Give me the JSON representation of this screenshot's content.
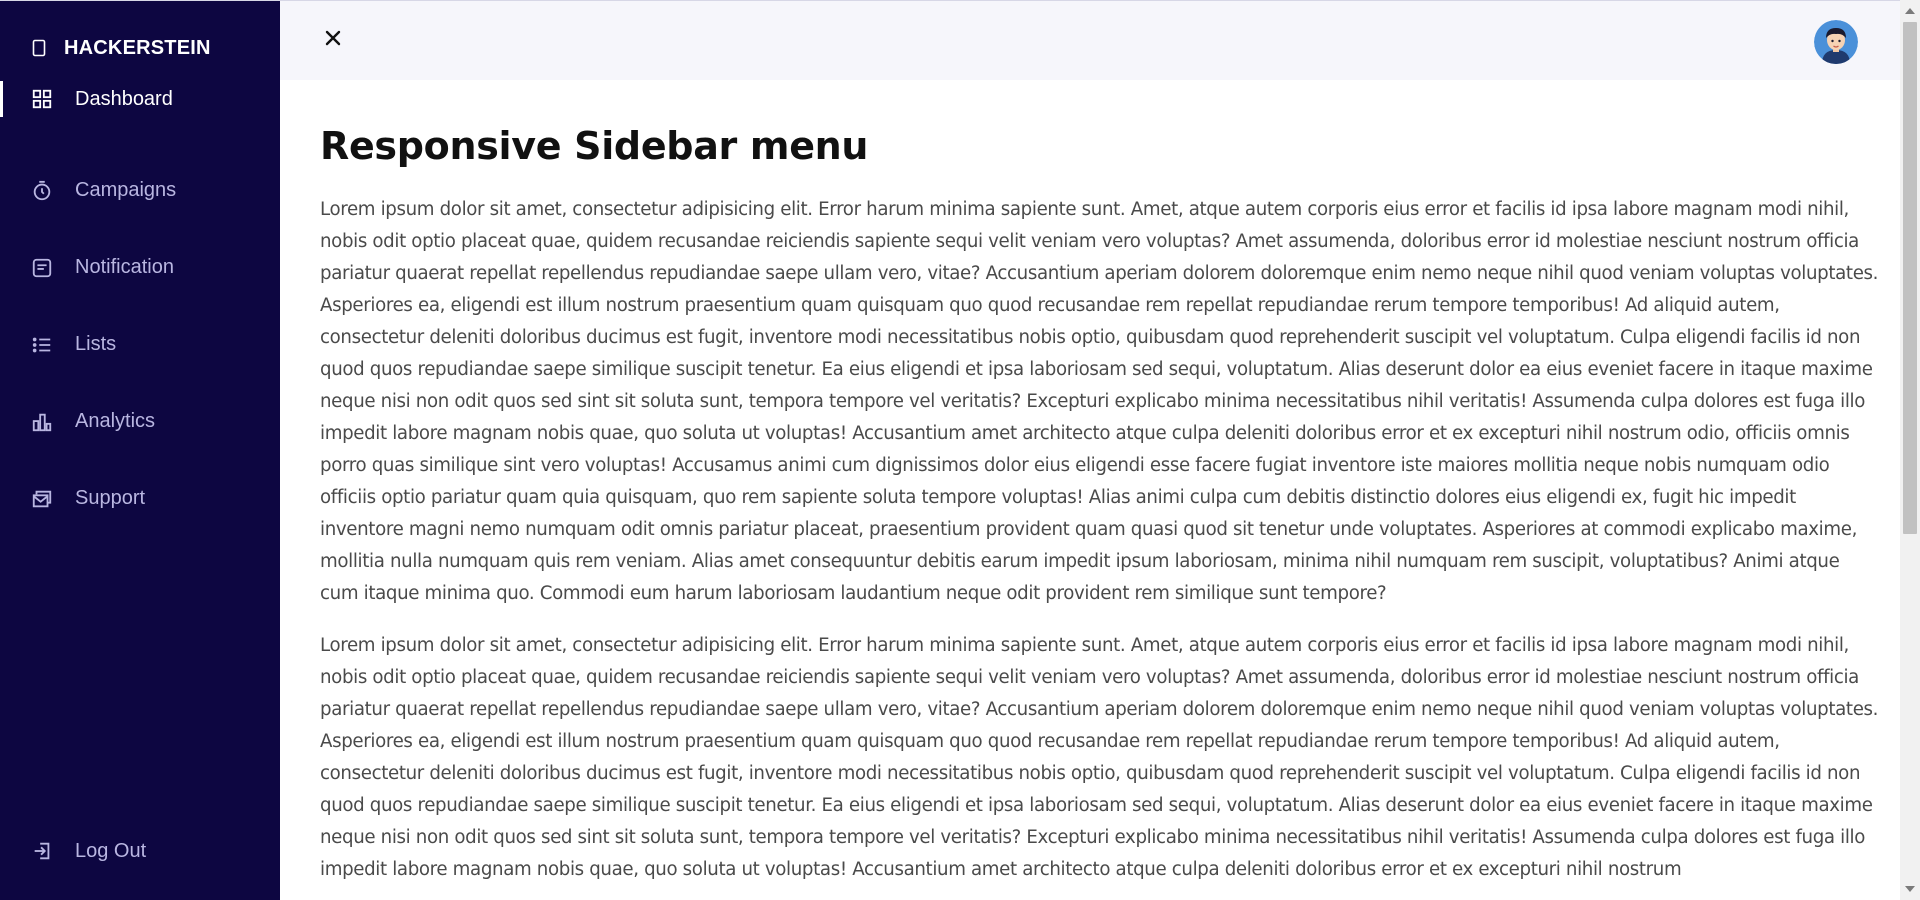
{
  "brand": {
    "name": "HACKERSTEIN",
    "icon": "brand-square-icon"
  },
  "sidebar": {
    "items": [
      {
        "label": "Dashboard",
        "icon": "dashboard-grid-icon",
        "active": true
      },
      {
        "label": "Campaigns",
        "icon": "stopwatch-icon",
        "active": false
      },
      {
        "label": "Notification",
        "icon": "message-icon",
        "active": false
      },
      {
        "label": "Lists",
        "icon": "list-icon",
        "active": false
      },
      {
        "label": "Analytics",
        "icon": "bar-chart-icon",
        "active": false
      },
      {
        "label": "Support",
        "icon": "support-mail-icon",
        "active": false
      }
    ],
    "logout": {
      "label": "Log Out",
      "icon": "logout-icon"
    }
  },
  "header": {
    "close_icon": "close-icon",
    "avatar": "user-avatar"
  },
  "main": {
    "title": "Responsive Sidebar menu",
    "paragraphs": [
      "Lorem ipsum dolor sit amet, consectetur adipisicing elit. Error harum minima sapiente sunt. Amet, atque autem corporis eius error et facilis id ipsa labore magnam modi nihil, nobis odit optio placeat quae, quidem recusandae reiciendis sapiente sequi velit veniam vero voluptas? Amet assumenda, doloribus error id molestiae nesciunt nostrum officia pariatur quaerat repellat repellendus repudiandae saepe ullam vero, vitae? Accusantium aperiam dolorem doloremque enim nemo neque nihil quod veniam voluptas voluptates. Asperiores ea, eligendi est illum nostrum praesentium quam quisquam quo quod recusandae rem repellat repudiandae rerum tempore temporibus! Ad aliquid autem, consectetur deleniti doloribus ducimus est fugit, inventore modi necessitatibus nobis optio, quibusdam quod reprehenderit suscipit vel voluptatum. Culpa eligendi facilis id non quod quos repudiandae saepe similique suscipit tenetur. Ea eius eligendi et ipsa laboriosam sed sequi, voluptatum. Alias deserunt dolor ea eius eveniet facere in itaque maxime neque nisi non odit quos sed sint sit soluta sunt, tempora tempore vel veritatis? Excepturi explicabo minima necessitatibus nihil veritatis! Assumenda culpa dolores est fuga illo impedit labore magnam nobis quae, quo soluta ut voluptas! Accusantium amet architecto atque culpa deleniti doloribus error et ex excepturi nihil nostrum odio, officiis omnis porro quas similique sint vero voluptas! Accusamus animi cum dignissimos dolor eius eligendi esse facere fugiat inventore iste maiores mollitia neque nobis numquam odio officiis optio pariatur quam quia quisquam, quo rem sapiente soluta tempore voluptas! Alias animi culpa cum debitis distinctio dolores eius eligendi ex, fugit hic impedit inventore magni nemo numquam odit omnis pariatur placeat, praesentium provident quam quasi quod sit tenetur unde voluptates. Asperiores at commodi explicabo maxime, mollitia nulla numquam quis rem veniam. Alias amet consequuntur debitis earum impedit ipsum laboriosam, minima nihil numquam rem suscipit, voluptatibus? Animi atque cum itaque minima quo. Commodi eum harum laboriosam laudantium neque odit provident rem similique sunt tempore?",
      "Lorem ipsum dolor sit amet, consectetur adipisicing elit. Error harum minima sapiente sunt. Amet, atque autem corporis eius error et facilis id ipsa labore magnam modi nihil, nobis odit optio placeat quae, quidem recusandae reiciendis sapiente sequi velit veniam vero voluptas? Amet assumenda, doloribus error id molestiae nesciunt nostrum officia pariatur quaerat repellat repellendus repudiandae saepe ullam vero, vitae? Accusantium aperiam dolorem doloremque enim nemo neque nihil quod veniam voluptas voluptates. Asperiores ea, eligendi est illum nostrum praesentium quam quisquam quo quod recusandae rem repellat repudiandae rerum tempore temporibus! Ad aliquid autem, consectetur deleniti doloribus ducimus est fugit, inventore modi necessitatibus nobis optio, quibusdam quod reprehenderit suscipit vel voluptatum. Culpa eligendi facilis id non quod quos repudiandae saepe similique suscipit tenetur. Ea eius eligendi et ipsa laboriosam sed sequi, voluptatum. Alias deserunt dolor ea eius eveniet facere in itaque maxime neque nisi non odit quos sed sint sit soluta sunt, tempora tempore vel veritatis? Excepturi explicabo minima necessitatibus nihil veritatis! Assumenda culpa dolores est fuga illo impedit labore magnam nobis quae, quo soluta ut voluptas! Accusantium amet architecto atque culpa deleniti doloribus error et ex excepturi nihil nostrum"
    ]
  },
  "colors": {
    "sidebar_bg": "#0d0641",
    "sidebar_text": "#b9b6e1",
    "active_text": "#ffffff",
    "header_bg": "#f6f6fb",
    "body_text": "#4a4a4a",
    "title_text": "#111111"
  }
}
